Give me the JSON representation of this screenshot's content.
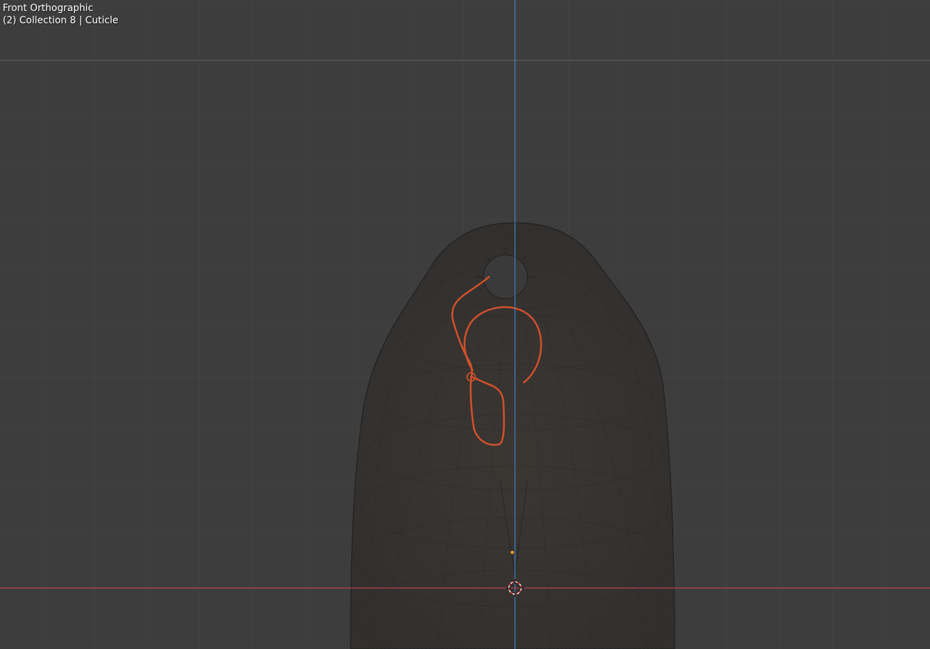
{
  "viewport": {
    "view_name": "Front Orthographic",
    "collection_info": "(2) Collection 8 | Cuticle",
    "colors": {
      "background": "#3d3d3d",
      "grid_minor": "#474747",
      "grid_major": "#555555",
      "x_axis": "#c1404f",
      "z_axis": "#3f84c7",
      "selection": "#d2512a",
      "mesh_wire": "#222222",
      "origin_point": "#ff9a1f"
    },
    "objects": [
      {
        "name": "mesh-body",
        "type": "mesh",
        "shading": "wireframe-xray"
      },
      {
        "name": "cuticle-curve",
        "type": "curve",
        "selected": true
      }
    ],
    "cursor_icon": "3d-cursor-icon"
  }
}
